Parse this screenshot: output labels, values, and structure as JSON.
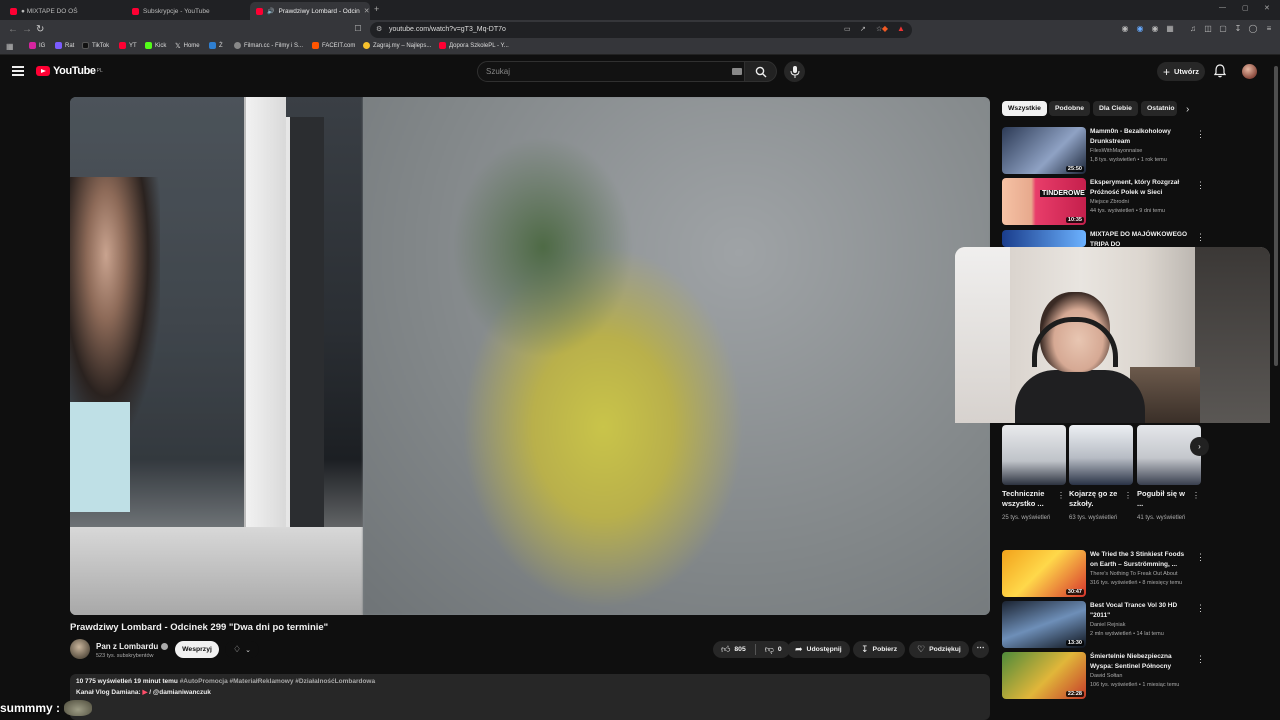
{
  "browser": {
    "tabs": [
      {
        "label": "● MIXTAPE DO OŚ",
        "active": false
      },
      {
        "label": "Subskrypcje - YouTube",
        "active": false
      },
      {
        "label": "Prawdziwy Lombard - Odcin",
        "active": true
      }
    ],
    "url": "youtube.com/watch?v=gT3_Mq-DT7o",
    "bookmarks": [
      "IG",
      "Rat",
      "TikTok",
      "YT",
      "Kick",
      "Home",
      "Ż",
      "Filman.cc - Filmy i S...",
      "FACEIT.com",
      "Zagraj.my – Najleps...",
      "Дорога SzkolePL - Y..."
    ]
  },
  "header": {
    "logo": "YouTube",
    "region": "PL",
    "search_placeholder": "Szukaj",
    "create_label": "Utwórz"
  },
  "video": {
    "title": "Prawdziwy Lombard - Odcinek 299 \"Dwa dni po terminie\"",
    "channel": "Pan z Lombardu",
    "subscribers": "523 tys. subskrybentów",
    "support_label": "Wesprzyj",
    "likes": "805",
    "dislikes": "0",
    "share_label": "Udostępnij",
    "download_label": "Pobierz",
    "thanks_label": "Podziękuj",
    "views_time": "10 775 wyświetleń  19 minut temu",
    "hashtags": "#AutoPromocja #MateriałReklamowy #DziałalnośćLombardowa",
    "desc_line2_prefix": "Kanał Vlog Damiana:",
    "desc_line2_handle": "/ @damianiwanczuk"
  },
  "chips": [
    "Wszystkie",
    "Podobne",
    "Dla Ciebie",
    "Ostatnio"
  ],
  "recommendations": [
    {
      "title": "Mamm0n - Bezalkoholowy Drunkstream",
      "channel": "FilesWithMayonnaise",
      "meta": "1,8 tys. wyświetleń • 1 rok temu",
      "duration": "25:50",
      "color1": "#2c3a55",
      "color2": "#8fa2c4"
    },
    {
      "title": "Eksperyment, który Rozgrzał Próżność Polek w Sieci",
      "channel": "Miejsce Zbrodni",
      "meta": "44 tys. wyświetleń • 9 dni temu",
      "duration": "10:35",
      "color1": "#e83d6a",
      "color2": "#f6c2a5"
    },
    {
      "title": "MIXTAPE DO MAJÓWKOWEGO TRIPA DO",
      "channel": "",
      "meta": "",
      "duration": "",
      "color1": "#1a3d8c",
      "color2": "#6cb2ff"
    },
    {
      "title": "We Tried the 3 Stinkiest Foods on Earth – Surströmming, ...",
      "channel": "There's Nothing To Freak Out About",
      "meta": "316 tys. wyświetleń • 8 miesięcy temu",
      "duration": "30:47",
      "color1": "#f2a21b",
      "color2": "#d6342c"
    },
    {
      "title": "Best Vocal Trance Vol 30 HD \"2011\"",
      "channel": "Daniel Rejniak",
      "meta": "2 mln wyświetleń • 14 lat temu",
      "duration": "13:30",
      "color1": "#1b2331",
      "color2": "#6e8fb8"
    },
    {
      "title": "Śmiertelnie Niebezpieczna Wyspa: Sentinel Północny",
      "channel": "Dawid Sołtan",
      "meta": "106 tys. wyświetleń • 1 miesiąc temu",
      "duration": "22:28",
      "color1": "#4e8a3a",
      "color2": "#e1b63a"
    }
  ],
  "shorts": [
    {
      "title": "Technicznie wszystko ...",
      "views": "25 tys. wyświetleń"
    },
    {
      "title": "Kojarzę go ze szkoły.",
      "views": "63 tys. wyświetleń"
    },
    {
      "title": "Pogubił się w ...",
      "views": "41 tys. wyświetleń"
    }
  ],
  "stream_chat": {
    "user": "summmy :"
  }
}
